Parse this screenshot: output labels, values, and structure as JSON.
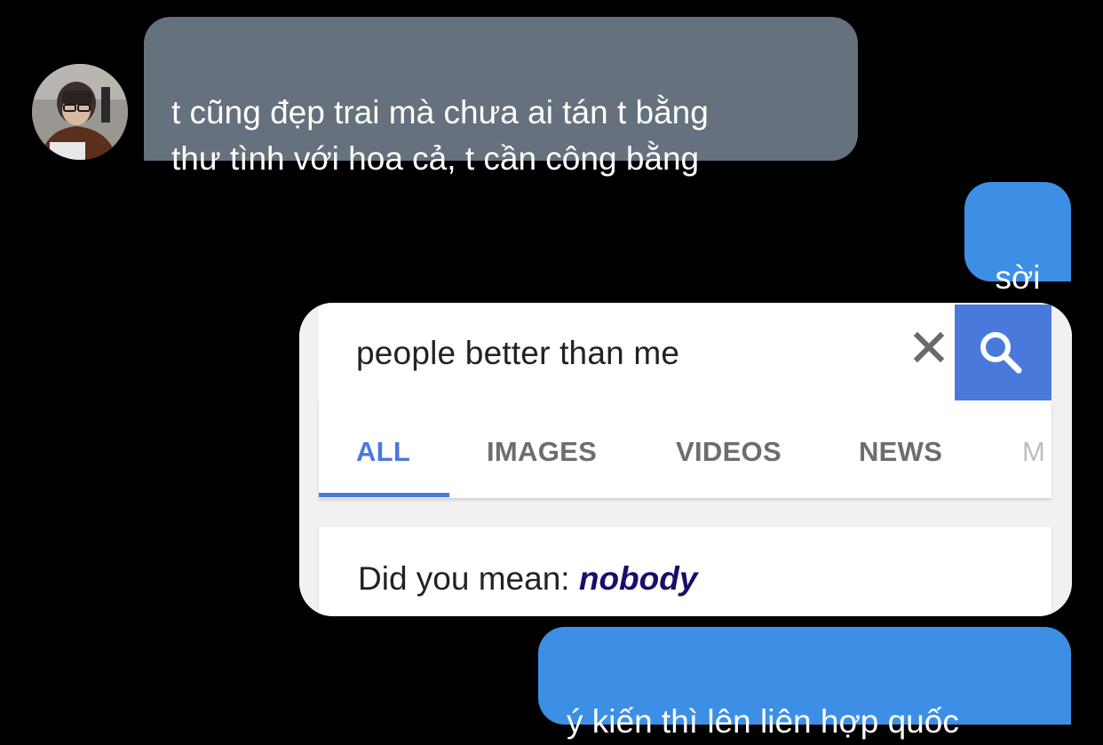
{
  "conversation": {
    "incoming_message": "t cũng đẹp trai mà chưa ai tán t bằng\nthư tình với hoa cả, t cần công bằng",
    "outgoing_message_1": "sời",
    "outgoing_message_2": "ý kiến thì lên liên hợp quốc"
  },
  "shared_image": {
    "search_query": "people better than me",
    "tabs": [
      "ALL",
      "IMAGES",
      "VIDEOS",
      "NEWS",
      "M"
    ],
    "active_tab": "ALL",
    "did_you_mean_label": "Did you mean: ",
    "suggestion": "nobody"
  },
  "icons": {
    "clear": "close-icon",
    "search": "search-icon"
  },
  "colors": {
    "background": "#000000",
    "incoming_bubble": "#65717d",
    "outgoing_bubble": "#3d8fe6",
    "search_accent": "#4a79dc",
    "suggestion_text": "#1a0d6b"
  }
}
